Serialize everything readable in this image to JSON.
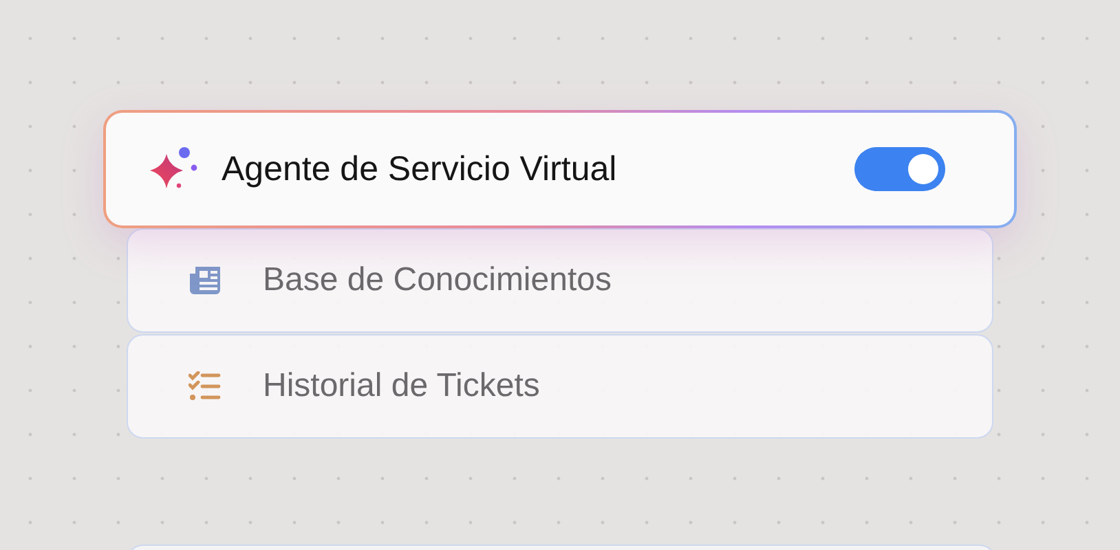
{
  "agent": {
    "title": "Agente de Servicio Virtual",
    "on": true
  },
  "items": [
    {
      "kind": "knowledge",
      "label": "Base de Conocimientos"
    },
    {
      "kind": "checklist",
      "label": "Historial de Tickets"
    }
  ]
}
